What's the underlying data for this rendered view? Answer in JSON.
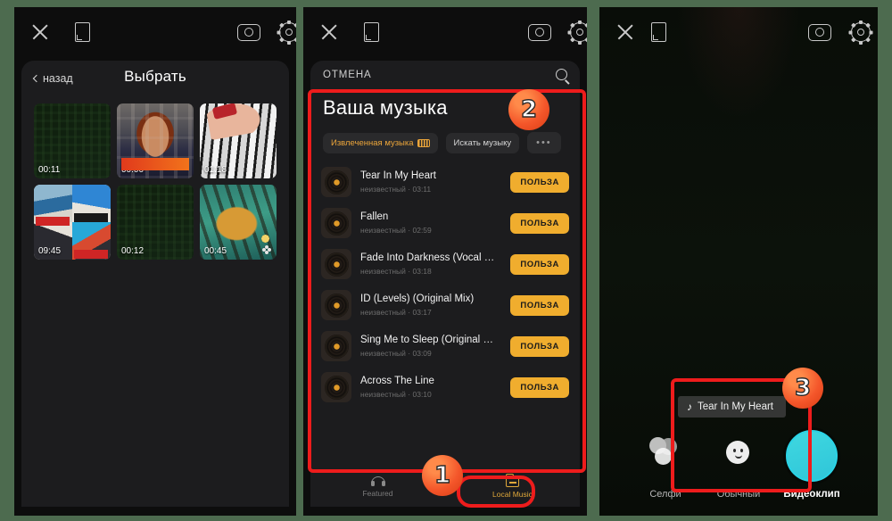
{
  "toolbar": {
    "close_label": "close-icon",
    "ratio_label": "aspect-ratio-icon",
    "camera_label": "camera-flip-icon",
    "settings_label": "settings-gear-icon"
  },
  "panel1": {
    "back_label": "назад",
    "title": "Выбрать",
    "thumbnails": [
      {
        "duration": "00:11",
        "art": "art-dark",
        "multi": false
      },
      {
        "duration": "00:00",
        "art": "art-woman",
        "multi": false
      },
      {
        "duration": "01:18",
        "art": "art-keys",
        "multi": false
      },
      {
        "duration": "09:45",
        "art": "art-collage",
        "multi": false
      },
      {
        "duration": "00:12",
        "art": "art-dark",
        "multi": false
      },
      {
        "duration": "00:45",
        "art": "art-tiger",
        "multi": true
      }
    ]
  },
  "panel2": {
    "cancel_label": "ОТМЕНА",
    "search_icon": "search-icon",
    "title": "Ваша музыка",
    "chips": [
      {
        "label": "Извлеченная  музыка",
        "badge": true,
        "style": "accent"
      },
      {
        "label": "Искать музыку",
        "badge": false,
        "style": "plain"
      },
      {
        "label": "•••",
        "badge": false,
        "style": "dots"
      }
    ],
    "use_button_label": "ПОЛЬЗА",
    "artist_unknown": "неизвестный",
    "tracks": [
      {
        "name": "Tear In My Heart",
        "artist": "неизвестный",
        "duration": "03:11"
      },
      {
        "name": "Fallen",
        "artist": "неизвестный",
        "duration": "02:59"
      },
      {
        "name": "Fade Into Darkness (Vocal Radio Edit)",
        "artist": "неизвестный",
        "duration": "03:18"
      },
      {
        "name": "ID (Levels) (Original Mix)",
        "artist": "неизвестный",
        "duration": "03:17"
      },
      {
        "name": "Sing Me to Sleep (Original Mix)",
        "artist": "неизвестный",
        "duration": "03:09"
      },
      {
        "name": "Across The Line",
        "artist": "неизвестный",
        "duration": "03:10"
      }
    ],
    "tabs": [
      {
        "label": "Featured",
        "icon": "headphones-icon",
        "active": false
      },
      {
        "label": "Local Music",
        "icon": "folder-icon",
        "active": true
      }
    ]
  },
  "panel3": {
    "now_playing": "Tear In My Heart",
    "note_icon": "music-note-icon",
    "modes": [
      {
        "label": "Селфи",
        "selected": false
      },
      {
        "label": "Обычный",
        "selected": false
      },
      {
        "label": "Видеоклип",
        "selected": true
      }
    ],
    "shutter_label": "shutter-button"
  },
  "annotations": {
    "badge1": "1",
    "badge2": "2",
    "badge3": "3",
    "accent_color": "#ee1c1c"
  }
}
